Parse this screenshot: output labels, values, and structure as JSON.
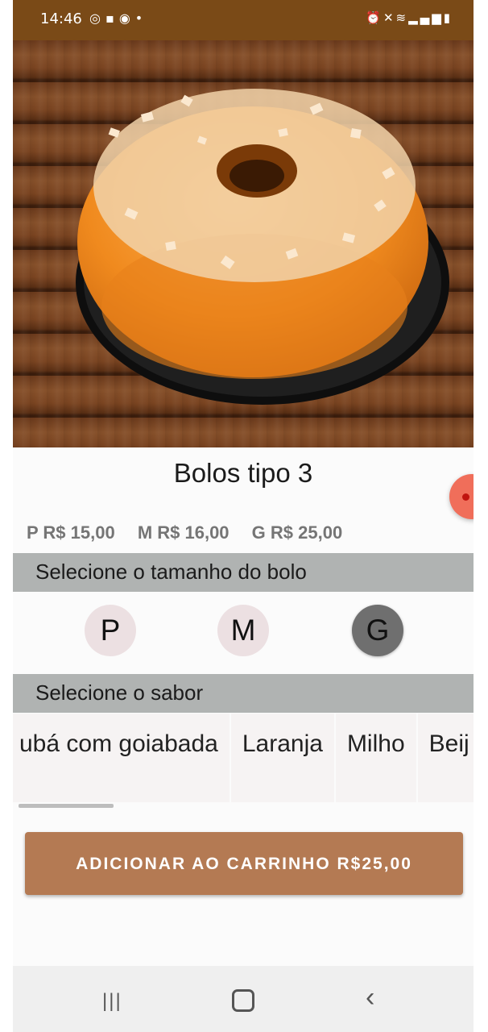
{
  "status_bar": {
    "time": "14:46",
    "left_icons": [
      "whatsapp-icon",
      "message-icon",
      "discord-icon",
      "dot-icon"
    ],
    "right_icons": [
      "alarm-icon",
      "mute-icon",
      "wifi-icon",
      "volte-icon",
      "signal-icon",
      "battery-icon"
    ]
  },
  "product": {
    "image_subject": "cake-photo",
    "title": "Bolos tipo 3",
    "prices": [
      "P R$ 15,00",
      "M R$ 16,00",
      "G R$ 25,00"
    ]
  },
  "size_section": {
    "label": "Selecione o tamanho do bolo",
    "options": [
      "P",
      "M",
      "G"
    ],
    "selected": "G"
  },
  "flavor_section": {
    "label": "Selecione o sabor",
    "options": [
      "ubá com goiabada",
      "Laranja",
      "Milho",
      "Beij"
    ]
  },
  "add_button": {
    "label": "ADICIONAR AO CARRINHO R$25,00"
  },
  "colors": {
    "status_bar": "#7a4a17",
    "section_bar": "#b0b3b2",
    "add_button": "#b47a53",
    "selected_size": "#6f6f6f",
    "unselected_size": "#ece0e2"
  }
}
